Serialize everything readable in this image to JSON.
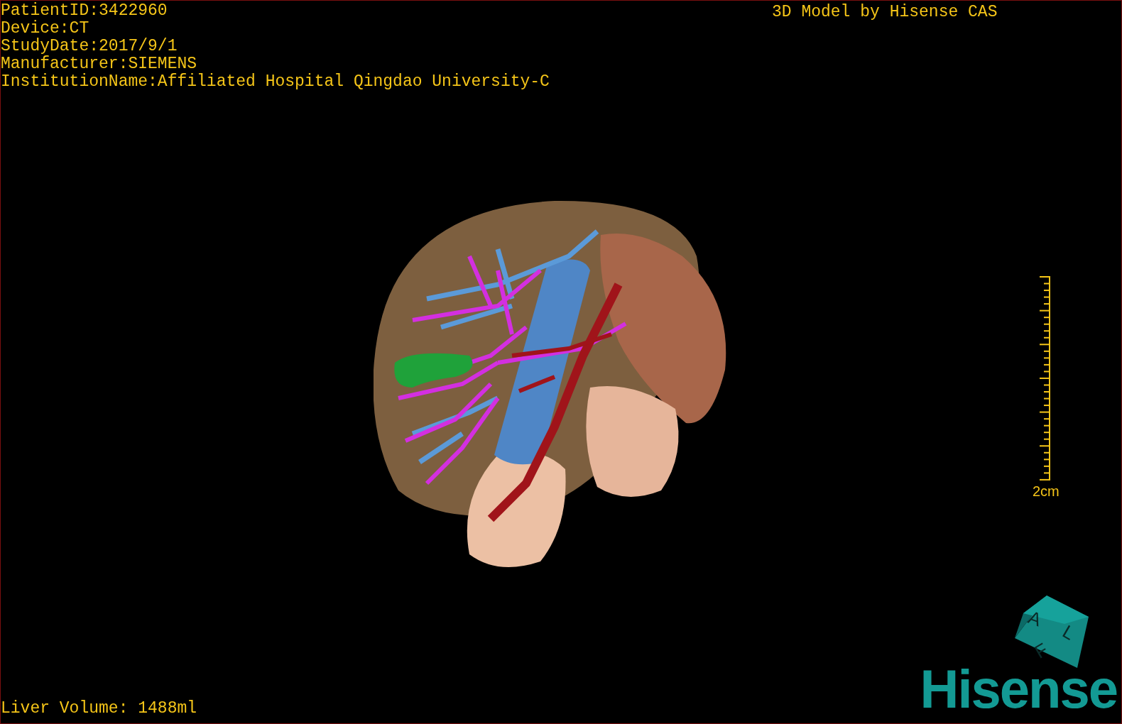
{
  "patient_info": [
    "PatientID:3422960",
    "Device:CT",
    "StudyDate:2017/9/1",
    "Manufacturer:SIEMENS",
    "InstitutionName:Affiliated Hospital Qingdao University-C"
  ],
  "model_caption": "3D Model by Hisense CAS",
  "scale_bar": {
    "label": "2cm"
  },
  "orientation_cube": {
    "labels": [
      "A",
      "L",
      "F"
    ]
  },
  "logo": "Hisense",
  "liver_volume": "Liver Volume: 1488ml"
}
